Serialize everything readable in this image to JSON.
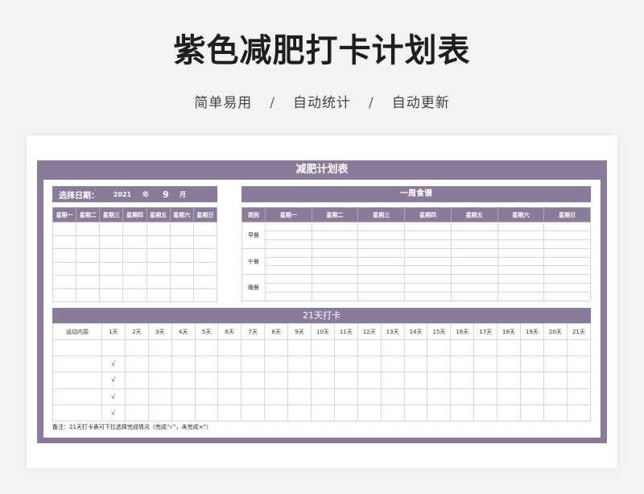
{
  "hero": {
    "title": "紫色减肥打卡计划表",
    "subtitle": [
      "简单易用",
      "自动统计",
      "自动更新"
    ],
    "separator": "/"
  },
  "sheet": {
    "title": "减肥计划表",
    "calendar": {
      "label": "选择日期：",
      "year": "2021",
      "year_label": "年",
      "month": "9",
      "month_label": "月",
      "weekdays": [
        "星期一",
        "星期二",
        "星期三",
        "星期四",
        "星期五",
        "星期六",
        "星期日"
      ]
    },
    "meal": {
      "title": "一周食谱",
      "headers": [
        "类别",
        "星期一",
        "星期二",
        "星期三",
        "星期四",
        "星期五",
        "星期六",
        "星期日"
      ],
      "rows": [
        "早餐",
        "午餐",
        "晚餐"
      ]
    },
    "checkin": {
      "title": "21天打卡",
      "first_header": "运动内容",
      "days": [
        "1天",
        "2天",
        "3天",
        "4天",
        "5天",
        "6天",
        "7天",
        "8天",
        "9天",
        "10天",
        "11天",
        "12天",
        "13天",
        "14天",
        "15天",
        "16天",
        "17天",
        "18天",
        "19天",
        "20天",
        "21天"
      ],
      "day1_marks": [
        "",
        "√",
        "√",
        "√",
        "√"
      ]
    },
    "note": "备注：21天打卡表可下拉选择完成情况（完成“√”，未完成×”）"
  },
  "colors": {
    "accent": "#8b7b9b",
    "grid": "#d9d4de"
  }
}
